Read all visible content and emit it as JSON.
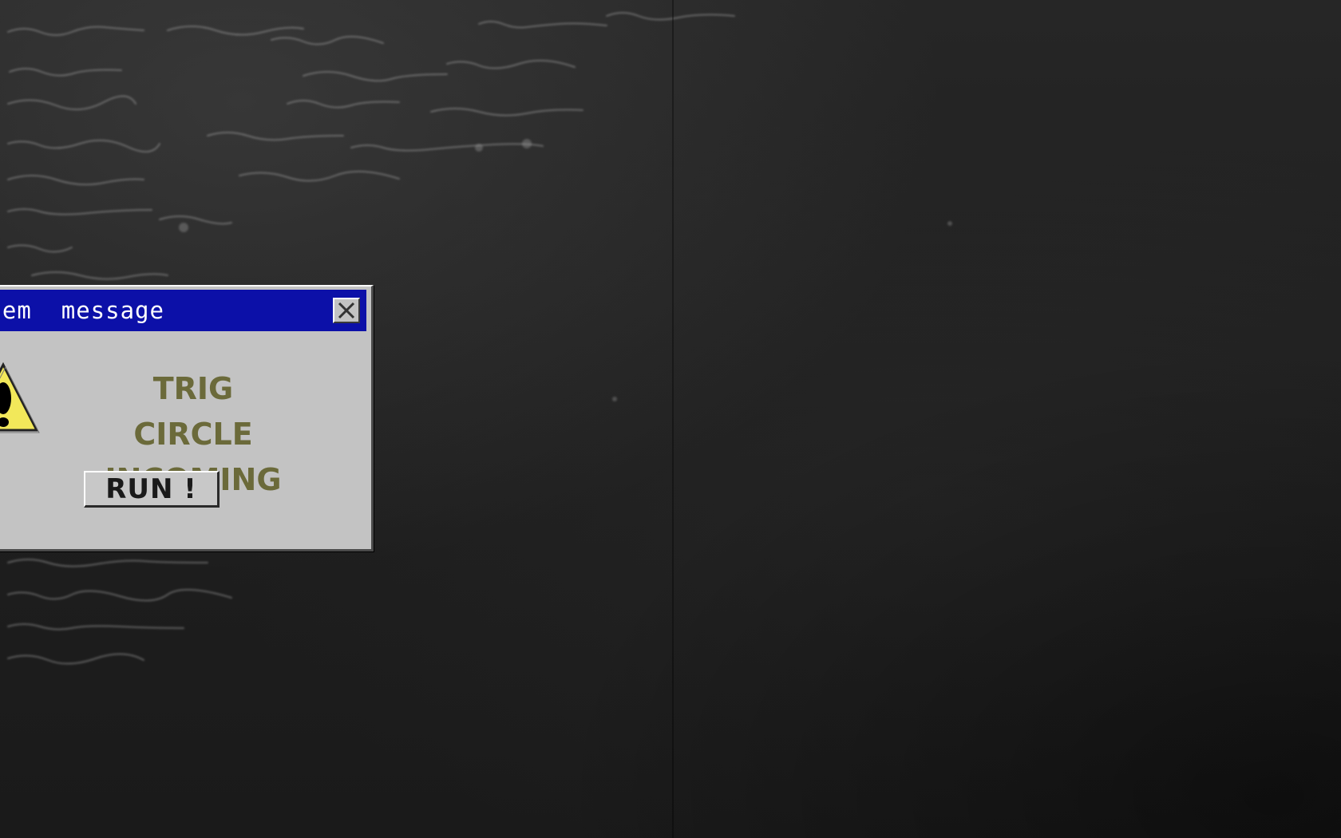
{
  "dialog": {
    "title": "stem  message",
    "message_line1": "TRIG CIRCLE",
    "message_line2": "INCOMING",
    "button_label": "RUN !",
    "close_icon": "close-icon",
    "warning_icon": "warning-icon"
  },
  "colors": {
    "titlebar": "#0c10a8",
    "dialog_bg": "#c3c3c3",
    "message_text": "#6b6a3a",
    "warning_yellow": "#f2e85a",
    "desktop_bg": "#1c1c1c"
  }
}
